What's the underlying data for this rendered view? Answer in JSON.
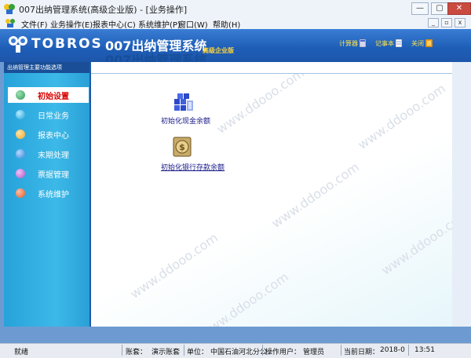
{
  "window": {
    "title": "007出纳管理系统(高级企业版) - [业务操作]"
  },
  "menu": [
    "文件(F)",
    "业务操作(E)",
    "报表中心(C)",
    "系统维护(P)",
    "窗口(W)",
    "帮助(H)"
  ],
  "banner": {
    "brand": "TOBROS",
    "product": "007出纳管理系统",
    "edition": "高级企业版",
    "tools": [
      {
        "label": "计算器",
        "icon": "calculator-icon"
      },
      {
        "label": "记事本",
        "icon": "notepad-icon"
      },
      {
        "label": "关闭",
        "icon": "close-icon"
      }
    ]
  },
  "sidebar": {
    "header": "出纳管理主要功能选项",
    "items": [
      {
        "label": "初始设置",
        "color": "#2e9b56",
        "active": true
      },
      {
        "label": "日常业务",
        "color": "#1fa0d8"
      },
      {
        "label": "报表中心",
        "color": "#f0a92a"
      },
      {
        "label": "末期处理",
        "color": "#2f86d6"
      },
      {
        "label": "票据管理",
        "color": "#b455c4"
      },
      {
        "label": "系统维护",
        "color": "#e2572a"
      }
    ]
  },
  "content": {
    "shortcuts": [
      {
        "label": "初始化现金余额",
        "icon": "cash-blocks-icon"
      },
      {
        "label": "初始化银行存款余额",
        "icon": "bank-coin-icon"
      }
    ],
    "watermark": "www.ddooo.com"
  },
  "status": {
    "ready": "就绪",
    "account_label": "账套：",
    "account": "演示账套",
    "unit_label": "单位：",
    "unit": "中国石油河北分公",
    "user_label": "操作用户：",
    "user": "管理员",
    "date_label": "当前日期：",
    "date": "2018-0",
    "time": "13:51"
  }
}
